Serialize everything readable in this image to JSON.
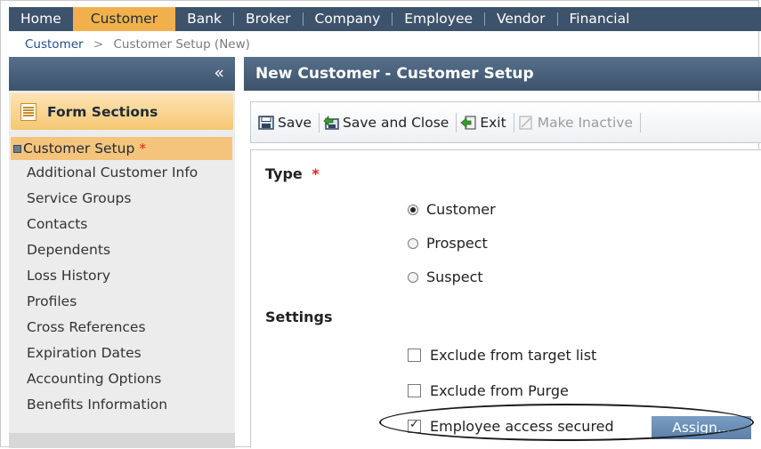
{
  "nav": {
    "items": [
      "Home",
      "Customer",
      "Bank",
      "Broker",
      "Company",
      "Employee",
      "Vendor",
      "Financial"
    ],
    "active": "Customer"
  },
  "breadcrumb": {
    "link": "Customer",
    "separator": ">",
    "current": "Customer Setup (New)"
  },
  "sidebar": {
    "collapse_glyph": "«",
    "header": "Form Sections",
    "active_section": "Customer Setup",
    "required_marker": "*",
    "sections": [
      "Additional Customer Info",
      "Service Groups",
      "Contacts",
      "Dependents",
      "Loss History",
      "Profiles",
      "Cross References",
      "Expiration Dates",
      "Accounting Options",
      "Benefits Information"
    ]
  },
  "main": {
    "title": "New Customer - Customer Setup"
  },
  "toolbar": {
    "save": "Save",
    "save_close": "Save and Close",
    "exit": "Exit",
    "make_inactive": "Make Inactive"
  },
  "form": {
    "type_label": "Type",
    "type_required": "*",
    "type_options": [
      "Customer",
      "Prospect",
      "Suspect"
    ],
    "type_selected": "Customer",
    "settings_label": "Settings",
    "settings": [
      {
        "label": "Exclude from target list",
        "checked": false
      },
      {
        "label": "Exclude from Purge",
        "checked": false
      },
      {
        "label": "Employee access secured",
        "checked": true
      }
    ],
    "checkmark_glyph": "✓",
    "assign_button": "Assign..."
  },
  "colors": {
    "nav_bg": "#3d536b",
    "nav_active": "#f2b04c",
    "panel_header": "#4a6179",
    "sections_header": "#f6c774",
    "active_section": "#f5c47c",
    "required": "#e02020",
    "assign_button": "#6a8db4"
  },
  "icons": {
    "form_sections": "list-document-icon",
    "save": "save-icon",
    "save_close": "save-close-icon",
    "exit": "exit-arrow-icon",
    "make_inactive": "disabled-document-icon",
    "customer_setup": "floppy-icon"
  }
}
